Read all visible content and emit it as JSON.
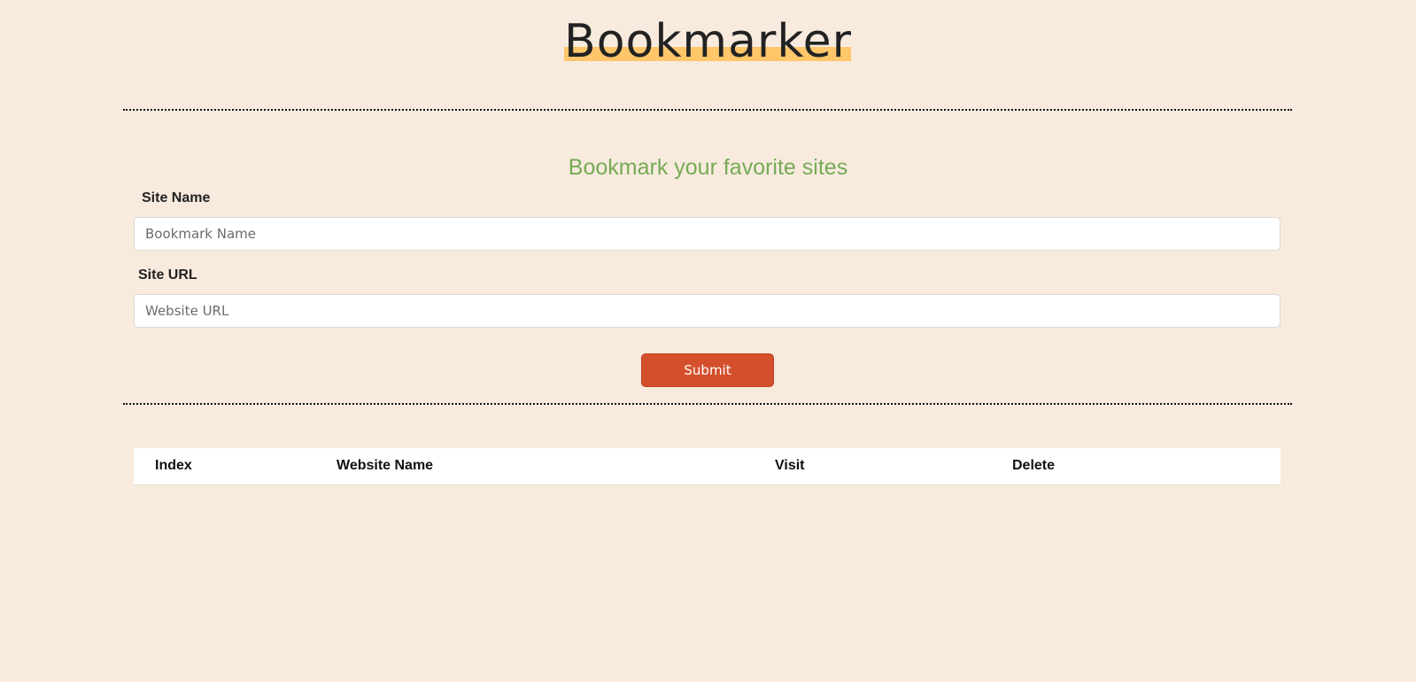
{
  "header": {
    "title": "Bookmarker"
  },
  "form": {
    "heading": "Bookmark your favorite sites",
    "site_name_label": "Site Name",
    "site_name_placeholder": "Bookmark Name",
    "site_name_value": "",
    "site_url_label": "Site URL",
    "site_url_placeholder": "Website URL",
    "site_url_value": "",
    "submit_label": "Submit"
  },
  "table": {
    "columns": [
      "Index",
      "Website Name",
      "Visit",
      "Delete"
    ],
    "rows": []
  },
  "colors": {
    "background": "#f8ebde",
    "logo_highlight": "#ffc66a",
    "heading": "#75ab55",
    "submit_button": "#d4502d"
  }
}
